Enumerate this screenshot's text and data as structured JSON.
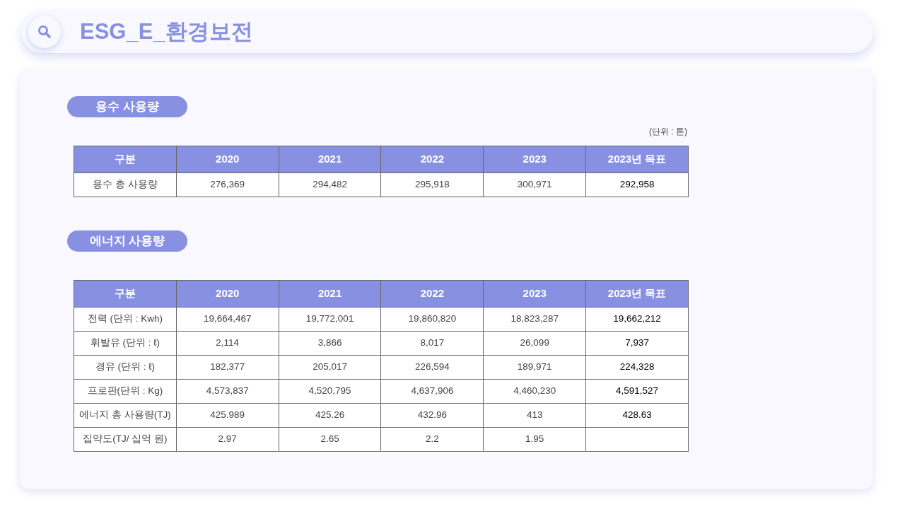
{
  "title": "ESG_E_환경보전",
  "sections": [
    {
      "heading": "용수 사용량",
      "unit": "(단위 : 톤)",
      "columns": [
        "구분",
        "2020",
        "2021",
        "2022",
        "2023",
        "2023년 목표"
      ],
      "rows": [
        [
          "용수 총 사용량",
          "276,369",
          "294,482",
          "295,918",
          "300,971",
          "292,958"
        ]
      ]
    },
    {
      "heading": "에너지 사용량",
      "columns": [
        "구분",
        "2020",
        "2021",
        "2022",
        "2023",
        "2023년 목표"
      ],
      "rows": [
        [
          "전력 (단위 : Kwh)",
          "19,664,467",
          "19,772,001",
          "19,860,820",
          "18,823,287",
          "19,662,212"
        ],
        [
          "휘발유 (단위 : ℓ)",
          "2,114",
          "3,866",
          "8,017",
          "26,099",
          "7,937"
        ],
        [
          "경유 (단위 : ℓ)",
          "182,377",
          "205,017",
          "226,594",
          "189,971",
          "224,328"
        ],
        [
          "프로판(단위 : Kg)",
          "4,573,837",
          "4,520,795",
          "4,637,906",
          "4,460,230",
          "4,591,527"
        ],
        [
          "에너지 총 사용량(TJ)",
          "425.989",
          "425.26",
          "432.96",
          "413",
          "428.63"
        ],
        [
          "집약도(TJ/ 십억 원)",
          "2.97",
          "2.65",
          "2.2",
          "1.95"
        ]
      ]
    }
  ]
}
